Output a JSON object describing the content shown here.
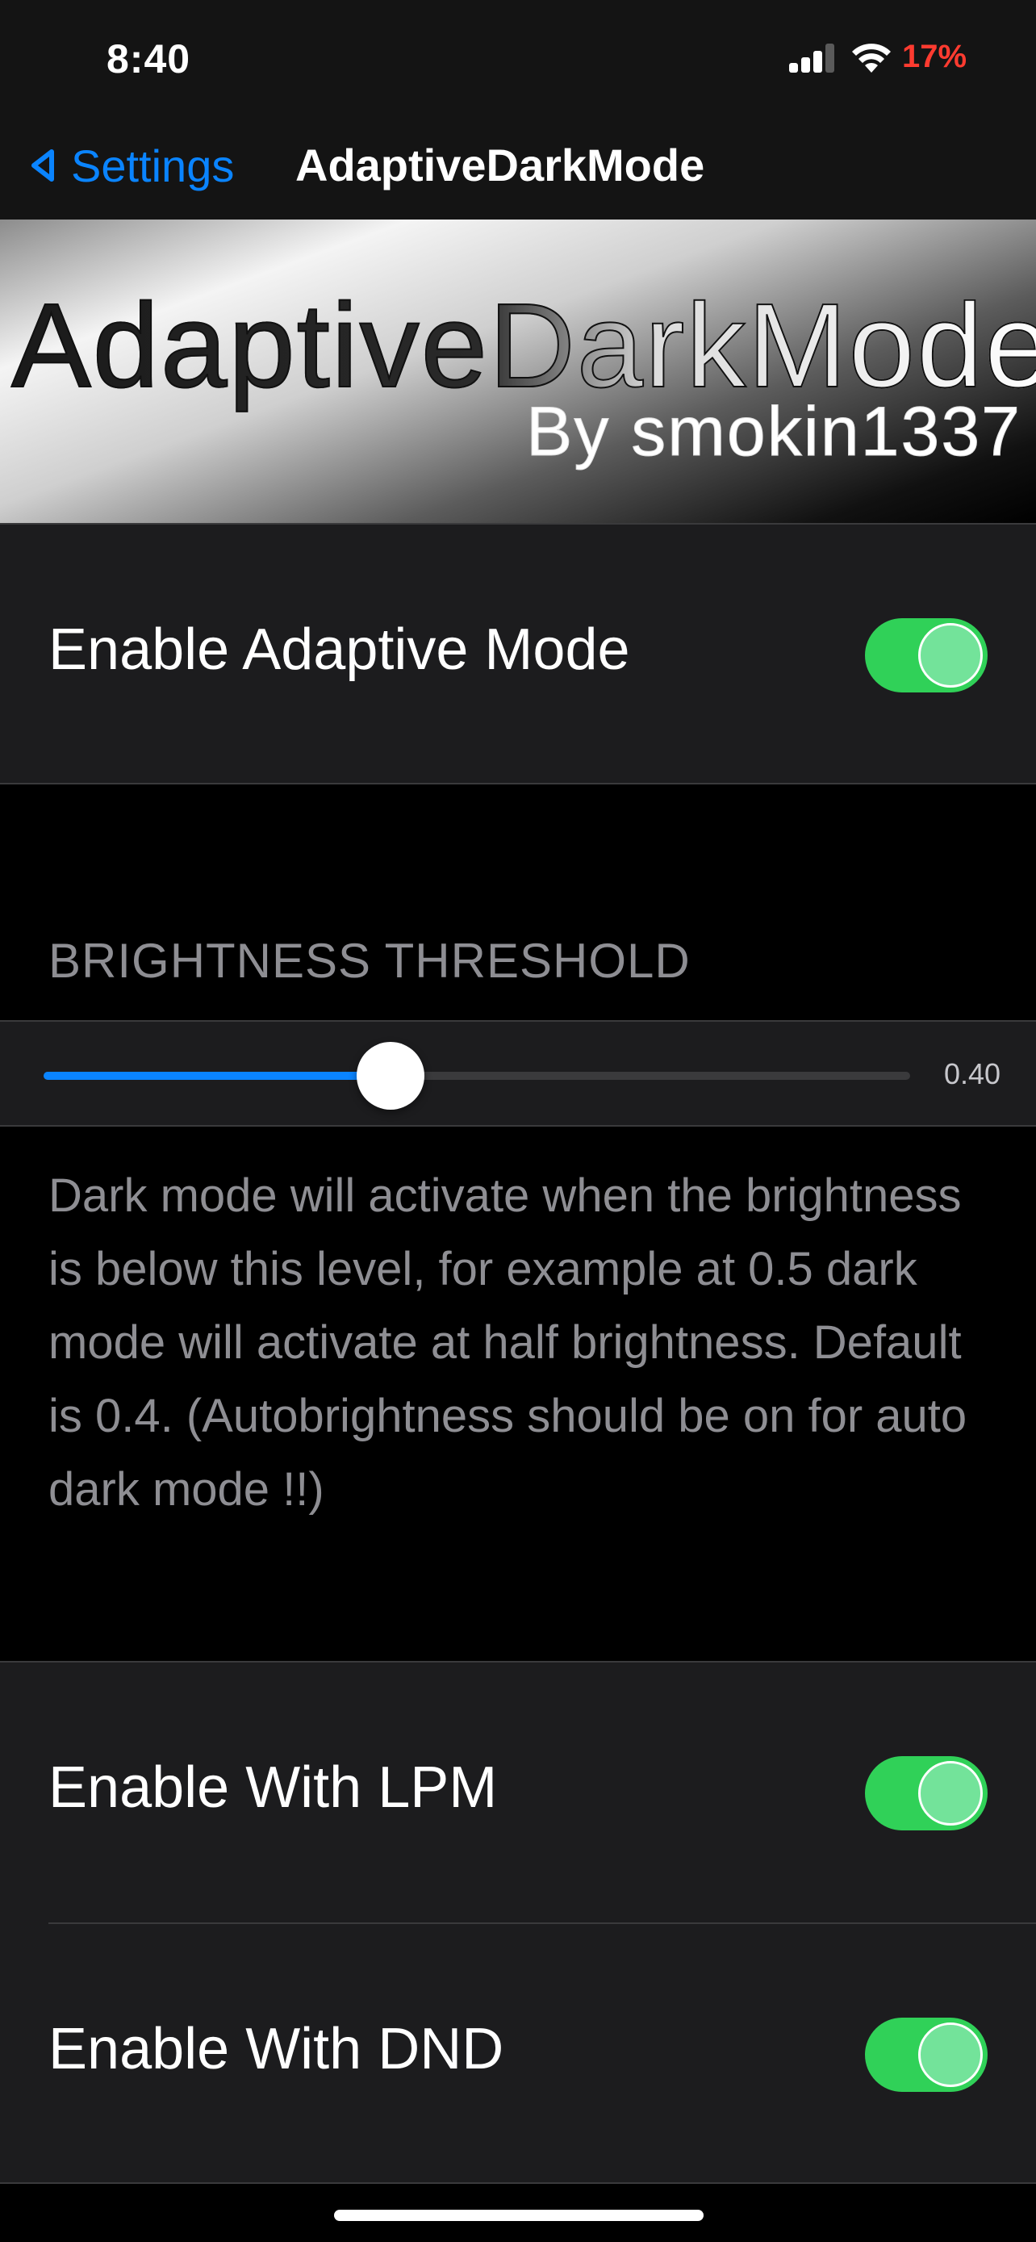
{
  "status_bar": {
    "time": "8:40",
    "battery_percent": "17%",
    "battery_color": "#ff3b30",
    "signal_bars_active": 3,
    "signal_bars_total": 4
  },
  "nav": {
    "back_label": "Settings",
    "title": "AdaptiveDarkMode"
  },
  "banner": {
    "title": "AdaptiveDarkMode",
    "subtitle": "By smokin1337"
  },
  "settings": {
    "adaptive_mode": {
      "label": "Enable Adaptive Mode",
      "on": true
    },
    "brightness": {
      "header": "BRIGHTNESS THRESHOLD",
      "value": 0.4,
      "value_label": "0.40",
      "footer": "Dark mode will activate when the brightness is below this level, for example at 0.5 dark mode will activate at half brightness. Default is 0.4. (Autobrightness should be on for auto dark mode !!)"
    },
    "lpm": {
      "label": "Enable With LPM",
      "on": true
    },
    "dnd": {
      "label": "Enable With DND",
      "on": true
    }
  },
  "colors": {
    "accent": "#0a84ff",
    "toggle_on": "#30d158",
    "background": "#000000",
    "cell": "#1c1c1e"
  }
}
